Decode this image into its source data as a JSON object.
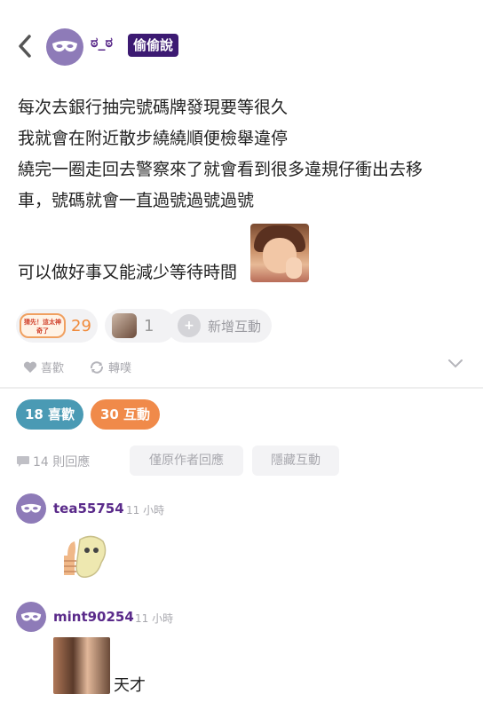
{
  "header": {
    "back_icon": "chevron-left-icon",
    "author": "ಠ_ಠ",
    "badge": "偷偷說"
  },
  "post": {
    "lines": [
      "每次去銀行抽完號碼牌發現要等很久",
      "我就會在附近散步繞繞順便檢舉違停",
      "繞完一圈走回去警察來了就會看到很多違規仔衝出去移",
      "車，號碼就會一直過號過號過號"
    ],
    "last_line": "可以做好事又能減少等待時間"
  },
  "reactions": {
    "sticker1_text": "猜先！這太神奇了",
    "count1": "29",
    "count2": "1",
    "add_label": "新增互動"
  },
  "actions": {
    "like_label": "喜歡",
    "share_label": "轉噗"
  },
  "stats": {
    "likes": "18 喜歡",
    "interactions": "30 互動"
  },
  "filters": {
    "reply_count": "14 則回應",
    "author_only": "僅原作者回應",
    "hide_interactions": "隱藏互動"
  },
  "comments": [
    {
      "user": "tea55754",
      "time": "11 小時"
    },
    {
      "user": "mint90254",
      "time": "11 小時",
      "text": "天才"
    }
  ],
  "colors": {
    "purple": "#5a2a8a",
    "badge": "#3c1a72",
    "likes_pill": "#4a9ab4",
    "interact_pill": "#f08a4a"
  }
}
